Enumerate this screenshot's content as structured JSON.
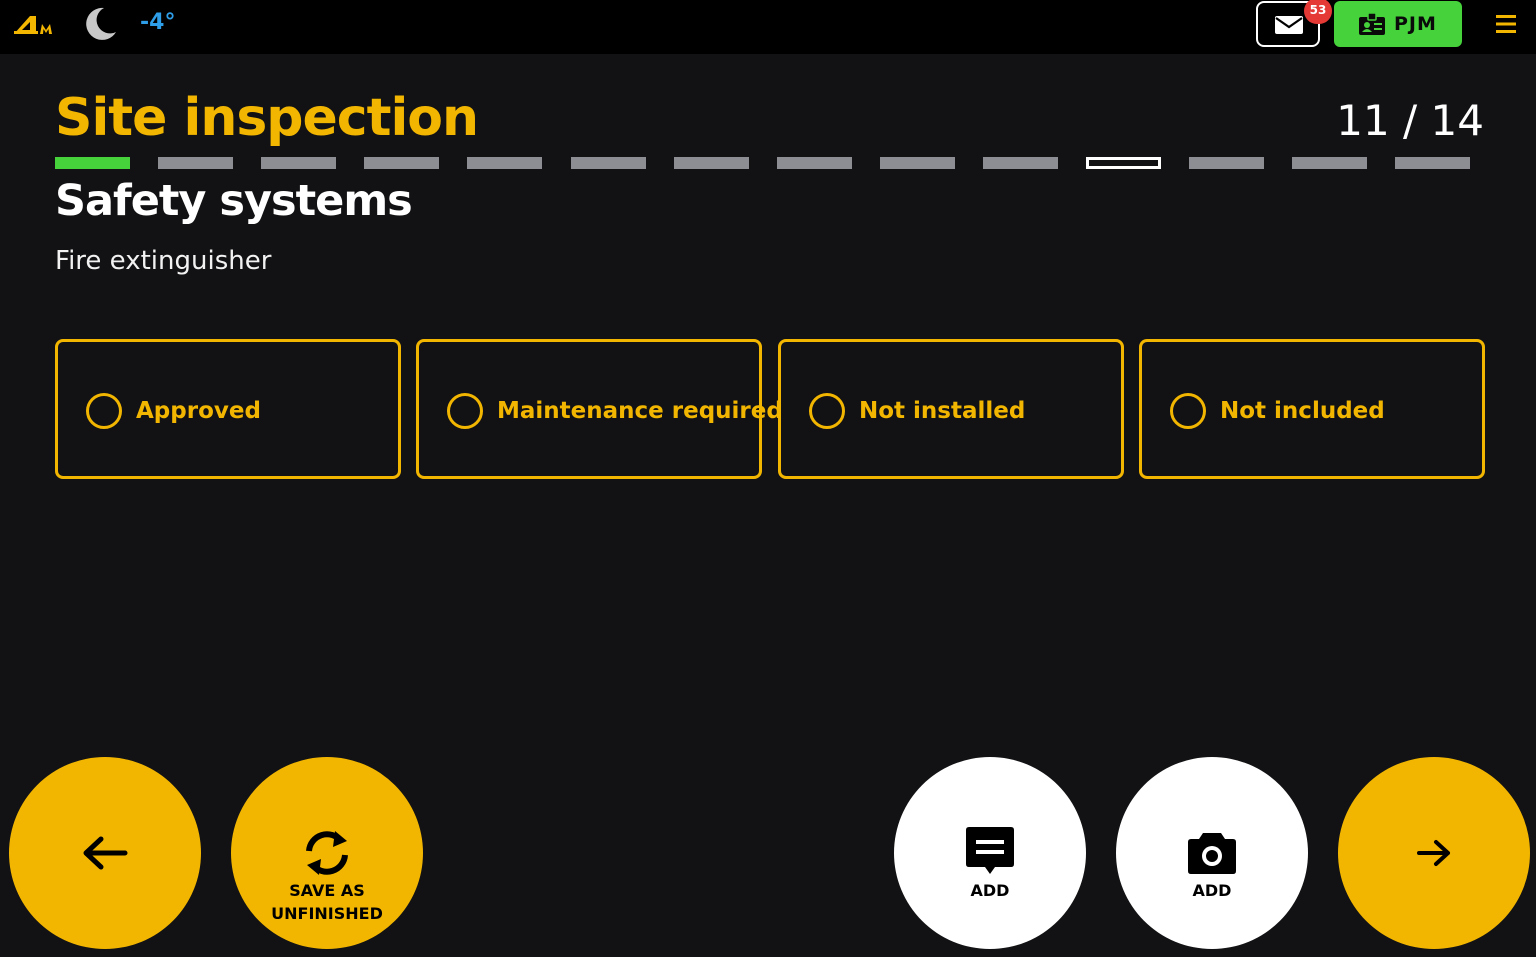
{
  "header": {
    "temperature": "-4°",
    "mail_badge_count": "53",
    "user_initials": "PJM",
    "colors": {
      "brand": "#f3b600",
      "user": "#45d23b",
      "badge": "#e53935",
      "temperature": "#2f9ee8"
    }
  },
  "page": {
    "title": "Site inspection",
    "counter": "11 / 14",
    "progress": {
      "total_steps": 14,
      "current_step": 11,
      "completed_steps": 1
    },
    "section": "Safety systems",
    "question": "Fire extinguisher"
  },
  "options": [
    {
      "label": "Approved"
    },
    {
      "label": "Maintenance required"
    },
    {
      "label": "Not installed"
    },
    {
      "label": "Not included"
    }
  ],
  "actions": {
    "back_icon": "arrow-left-icon",
    "save_line1": "SAVE AS",
    "save_line2": "UNFINISHED",
    "add_comment_label": "ADD",
    "add_photo_label": "ADD",
    "next_icon": "arrow-right-icon"
  }
}
